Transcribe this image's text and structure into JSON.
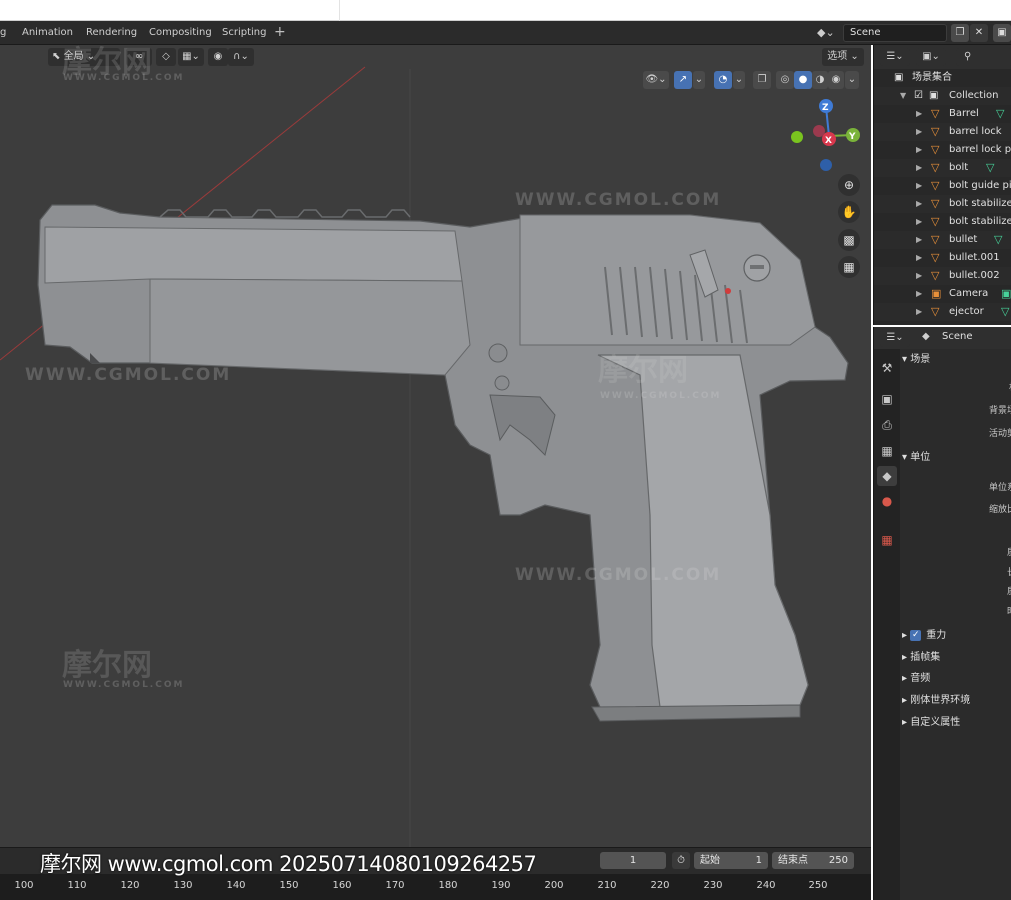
{
  "workspace_tabs": [
    "g",
    "Animation",
    "Rendering",
    "Compositing",
    "Scripting"
  ],
  "add_workspace": "+",
  "scene_selector": {
    "value": "Scene"
  },
  "viewport": {
    "transform_label": "全局",
    "options_label": "选项",
    "gizmo": {
      "z": "Z",
      "y": "Y",
      "x": "X"
    },
    "watermarks": [
      "WWW.CGMOL.COM",
      "WWW.CGMOL.COM",
      "WWW.CGMOL.COM",
      "WWW.CGMOL.COM",
      "WWW.CGMOL.COM"
    ],
    "watermark_cn": "摩尔网",
    "watermark_small": "WWW.CGMOL.COM"
  },
  "timeline": {
    "current_frame": "1",
    "start_label": "起始",
    "start_value": "1",
    "end_label": "结束点",
    "end_value": "250",
    "ticks": [
      "100",
      "110",
      "120",
      "130",
      "140",
      "150",
      "160",
      "170",
      "180",
      "190",
      "200",
      "210",
      "220",
      "230",
      "240",
      "250"
    ],
    "overlay_text": "摩尔网 www.cgmol.com 20250714080109264257"
  },
  "outliner": {
    "root": "场景集合",
    "collection": "Collection",
    "items": [
      "Barrel",
      "barrel lock",
      "barrel lock pin",
      "bolt",
      "bolt guide pin",
      "bolt stabilizer",
      "bolt stabilizer",
      "bullet",
      "bullet.001",
      "bullet.002",
      "Camera",
      "ejector"
    ]
  },
  "properties": {
    "header_scene": "Scene",
    "panels": {
      "scene": "场景",
      "scene_rows": [
        "相",
        "背景场",
        "活动剪"
      ],
      "units": "单位",
      "units_rows": [
        "单位系",
        "缩放比",
        "质",
        "长",
        "质",
        "时"
      ],
      "gravity": "重力",
      "keying_sets": "插帧集",
      "audio": "音频",
      "rigid_body": "刚体世界环境",
      "custom_props": "自定义属性"
    }
  }
}
